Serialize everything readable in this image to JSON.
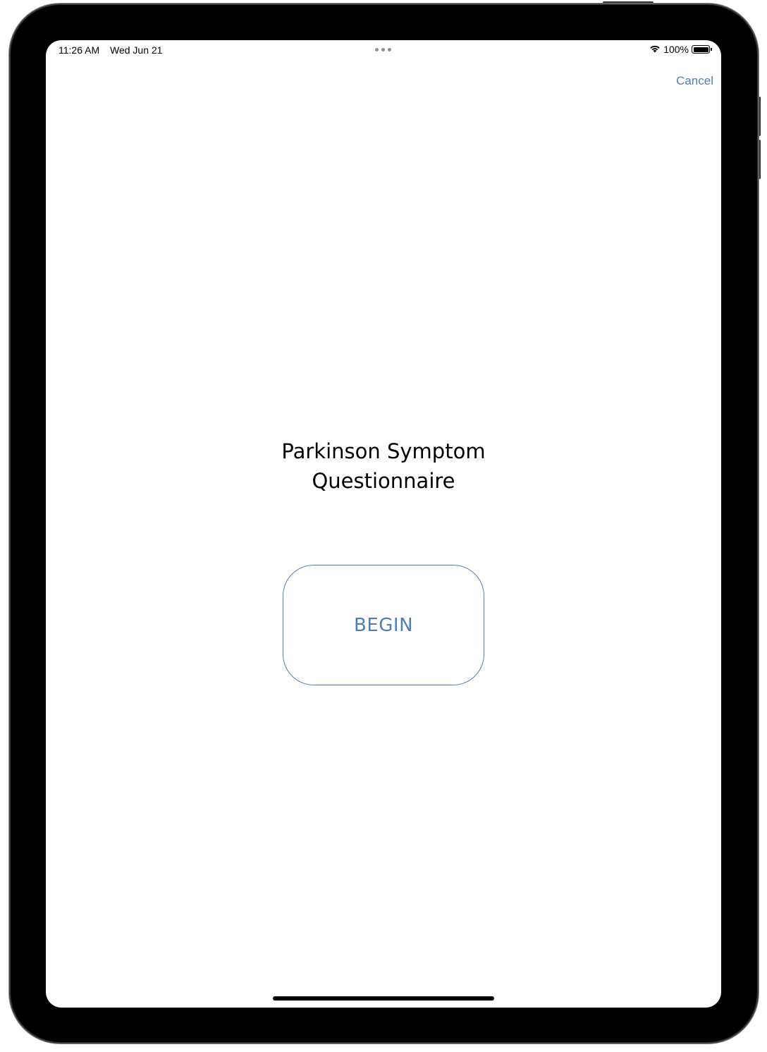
{
  "status_bar": {
    "time": "11:26 AM",
    "date": "Wed Jun 21",
    "battery_percent": "100%",
    "battery_level": 1.0,
    "icons": [
      "wifi-icon",
      "battery-icon",
      "multitasking-dots-icon"
    ]
  },
  "nav": {
    "cancel_label": "Cancel"
  },
  "main": {
    "title_line1": "Parkinson Symptom",
    "title_line2": "Questionnaire",
    "begin_label": "BEGIN"
  },
  "colors": {
    "accent": "#4f7fb3",
    "text": "#000000",
    "background": "#ffffff"
  }
}
